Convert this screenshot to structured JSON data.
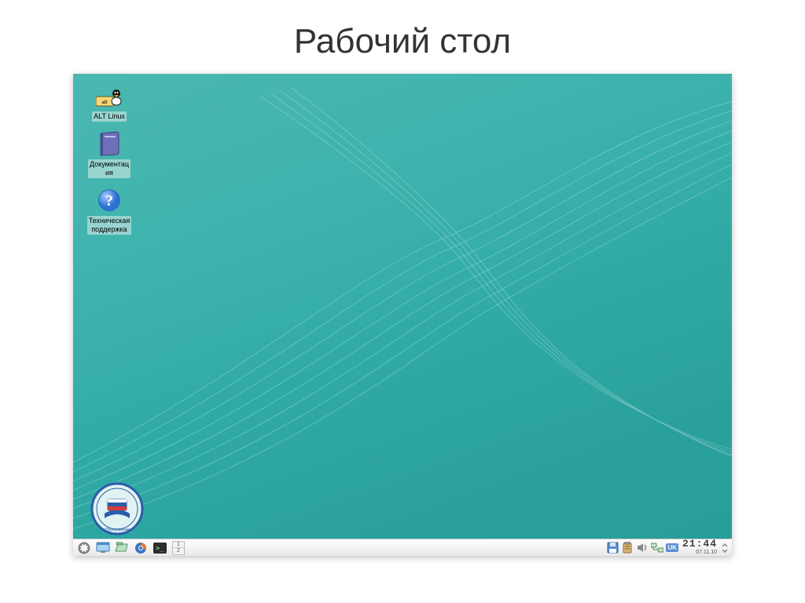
{
  "slide": {
    "title": "Рабочий стол"
  },
  "desktop": {
    "icons": [
      {
        "name": "alt-linux-icon",
        "label": "ALT Linux"
      },
      {
        "name": "documentation-icon",
        "label": "Документац\nия"
      },
      {
        "name": "support-icon",
        "label": "Техническая\nподдержка"
      }
    ],
    "corner_logo_text": "«Образование»"
  },
  "taskbar": {
    "quicklaunch": [
      {
        "name": "start-menu-icon"
      },
      {
        "name": "show-desktop-icon"
      },
      {
        "name": "file-manager-icon"
      },
      {
        "name": "browser-icon"
      },
      {
        "name": "terminal-icon"
      }
    ],
    "pager": [
      "1",
      "2"
    ],
    "tray": {
      "icons": [
        {
          "name": "save-device-icon"
        },
        {
          "name": "clipboard-icon"
        },
        {
          "name": "volume-icon"
        },
        {
          "name": "network-icon"
        }
      ],
      "language": "UK",
      "time": "21:44",
      "date": "07.11.10"
    }
  }
}
